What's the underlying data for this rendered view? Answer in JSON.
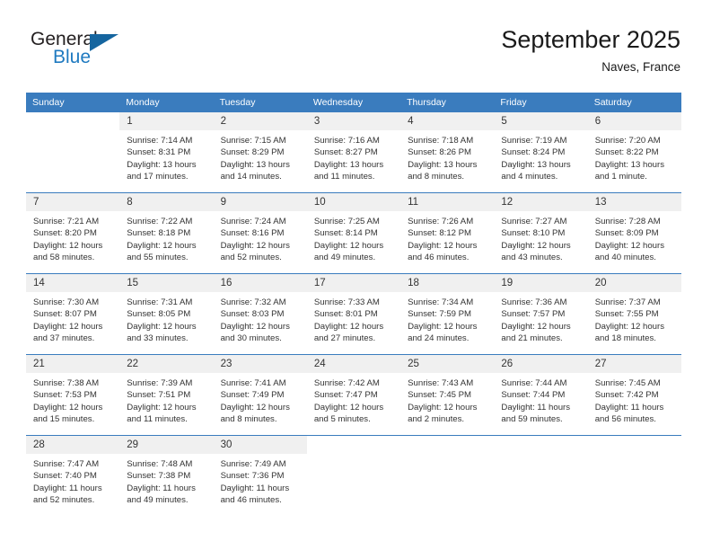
{
  "brand": {
    "name_top": "General",
    "name_bottom": "Blue",
    "accent_color": "#1f7ac0",
    "logo_triangle_color": "#15659f"
  },
  "header": {
    "title": "September 2025",
    "subtitle": "Naves, France"
  },
  "calendar": {
    "header_bg": "#3a7cbe",
    "daynum_bg": "#f0f0f0",
    "weekdays": [
      "Sunday",
      "Monday",
      "Tuesday",
      "Wednesday",
      "Thursday",
      "Friday",
      "Saturday"
    ],
    "weeks": [
      [
        {
          "day": "",
          "sunrise": "",
          "sunset": "",
          "daylight1": "",
          "daylight2": ""
        },
        {
          "day": "1",
          "sunrise": "Sunrise: 7:14 AM",
          "sunset": "Sunset: 8:31 PM",
          "daylight1": "Daylight: 13 hours",
          "daylight2": "and 17 minutes."
        },
        {
          "day": "2",
          "sunrise": "Sunrise: 7:15 AM",
          "sunset": "Sunset: 8:29 PM",
          "daylight1": "Daylight: 13 hours",
          "daylight2": "and 14 minutes."
        },
        {
          "day": "3",
          "sunrise": "Sunrise: 7:16 AM",
          "sunset": "Sunset: 8:27 PM",
          "daylight1": "Daylight: 13 hours",
          "daylight2": "and 11 minutes."
        },
        {
          "day": "4",
          "sunrise": "Sunrise: 7:18 AM",
          "sunset": "Sunset: 8:26 PM",
          "daylight1": "Daylight: 13 hours",
          "daylight2": "and 8 minutes."
        },
        {
          "day": "5",
          "sunrise": "Sunrise: 7:19 AM",
          "sunset": "Sunset: 8:24 PM",
          "daylight1": "Daylight: 13 hours",
          "daylight2": "and 4 minutes."
        },
        {
          "day": "6",
          "sunrise": "Sunrise: 7:20 AM",
          "sunset": "Sunset: 8:22 PM",
          "daylight1": "Daylight: 13 hours",
          "daylight2": "and 1 minute."
        }
      ],
      [
        {
          "day": "7",
          "sunrise": "Sunrise: 7:21 AM",
          "sunset": "Sunset: 8:20 PM",
          "daylight1": "Daylight: 12 hours",
          "daylight2": "and 58 minutes."
        },
        {
          "day": "8",
          "sunrise": "Sunrise: 7:22 AM",
          "sunset": "Sunset: 8:18 PM",
          "daylight1": "Daylight: 12 hours",
          "daylight2": "and 55 minutes."
        },
        {
          "day": "9",
          "sunrise": "Sunrise: 7:24 AM",
          "sunset": "Sunset: 8:16 PM",
          "daylight1": "Daylight: 12 hours",
          "daylight2": "and 52 minutes."
        },
        {
          "day": "10",
          "sunrise": "Sunrise: 7:25 AM",
          "sunset": "Sunset: 8:14 PM",
          "daylight1": "Daylight: 12 hours",
          "daylight2": "and 49 minutes."
        },
        {
          "day": "11",
          "sunrise": "Sunrise: 7:26 AM",
          "sunset": "Sunset: 8:12 PM",
          "daylight1": "Daylight: 12 hours",
          "daylight2": "and 46 minutes."
        },
        {
          "day": "12",
          "sunrise": "Sunrise: 7:27 AM",
          "sunset": "Sunset: 8:10 PM",
          "daylight1": "Daylight: 12 hours",
          "daylight2": "and 43 minutes."
        },
        {
          "day": "13",
          "sunrise": "Sunrise: 7:28 AM",
          "sunset": "Sunset: 8:09 PM",
          "daylight1": "Daylight: 12 hours",
          "daylight2": "and 40 minutes."
        }
      ],
      [
        {
          "day": "14",
          "sunrise": "Sunrise: 7:30 AM",
          "sunset": "Sunset: 8:07 PM",
          "daylight1": "Daylight: 12 hours",
          "daylight2": "and 37 minutes."
        },
        {
          "day": "15",
          "sunrise": "Sunrise: 7:31 AM",
          "sunset": "Sunset: 8:05 PM",
          "daylight1": "Daylight: 12 hours",
          "daylight2": "and 33 minutes."
        },
        {
          "day": "16",
          "sunrise": "Sunrise: 7:32 AM",
          "sunset": "Sunset: 8:03 PM",
          "daylight1": "Daylight: 12 hours",
          "daylight2": "and 30 minutes."
        },
        {
          "day": "17",
          "sunrise": "Sunrise: 7:33 AM",
          "sunset": "Sunset: 8:01 PM",
          "daylight1": "Daylight: 12 hours",
          "daylight2": "and 27 minutes."
        },
        {
          "day": "18",
          "sunrise": "Sunrise: 7:34 AM",
          "sunset": "Sunset: 7:59 PM",
          "daylight1": "Daylight: 12 hours",
          "daylight2": "and 24 minutes."
        },
        {
          "day": "19",
          "sunrise": "Sunrise: 7:36 AM",
          "sunset": "Sunset: 7:57 PM",
          "daylight1": "Daylight: 12 hours",
          "daylight2": "and 21 minutes."
        },
        {
          "day": "20",
          "sunrise": "Sunrise: 7:37 AM",
          "sunset": "Sunset: 7:55 PM",
          "daylight1": "Daylight: 12 hours",
          "daylight2": "and 18 minutes."
        }
      ],
      [
        {
          "day": "21",
          "sunrise": "Sunrise: 7:38 AM",
          "sunset": "Sunset: 7:53 PM",
          "daylight1": "Daylight: 12 hours",
          "daylight2": "and 15 minutes."
        },
        {
          "day": "22",
          "sunrise": "Sunrise: 7:39 AM",
          "sunset": "Sunset: 7:51 PM",
          "daylight1": "Daylight: 12 hours",
          "daylight2": "and 11 minutes."
        },
        {
          "day": "23",
          "sunrise": "Sunrise: 7:41 AM",
          "sunset": "Sunset: 7:49 PM",
          "daylight1": "Daylight: 12 hours",
          "daylight2": "and 8 minutes."
        },
        {
          "day": "24",
          "sunrise": "Sunrise: 7:42 AM",
          "sunset": "Sunset: 7:47 PM",
          "daylight1": "Daylight: 12 hours",
          "daylight2": "and 5 minutes."
        },
        {
          "day": "25",
          "sunrise": "Sunrise: 7:43 AM",
          "sunset": "Sunset: 7:45 PM",
          "daylight1": "Daylight: 12 hours",
          "daylight2": "and 2 minutes."
        },
        {
          "day": "26",
          "sunrise": "Sunrise: 7:44 AM",
          "sunset": "Sunset: 7:44 PM",
          "daylight1": "Daylight: 11 hours",
          "daylight2": "and 59 minutes."
        },
        {
          "day": "27",
          "sunrise": "Sunrise: 7:45 AM",
          "sunset": "Sunset: 7:42 PM",
          "daylight1": "Daylight: 11 hours",
          "daylight2": "and 56 minutes."
        }
      ],
      [
        {
          "day": "28",
          "sunrise": "Sunrise: 7:47 AM",
          "sunset": "Sunset: 7:40 PM",
          "daylight1": "Daylight: 11 hours",
          "daylight2": "and 52 minutes."
        },
        {
          "day": "29",
          "sunrise": "Sunrise: 7:48 AM",
          "sunset": "Sunset: 7:38 PM",
          "daylight1": "Daylight: 11 hours",
          "daylight2": "and 49 minutes."
        },
        {
          "day": "30",
          "sunrise": "Sunrise: 7:49 AM",
          "sunset": "Sunset: 7:36 PM",
          "daylight1": "Daylight: 11 hours",
          "daylight2": "and 46 minutes."
        },
        {
          "day": "",
          "sunrise": "",
          "sunset": "",
          "daylight1": "",
          "daylight2": ""
        },
        {
          "day": "",
          "sunrise": "",
          "sunset": "",
          "daylight1": "",
          "daylight2": ""
        },
        {
          "day": "",
          "sunrise": "",
          "sunset": "",
          "daylight1": "",
          "daylight2": ""
        },
        {
          "day": "",
          "sunrise": "",
          "sunset": "",
          "daylight1": "",
          "daylight2": ""
        }
      ]
    ]
  }
}
